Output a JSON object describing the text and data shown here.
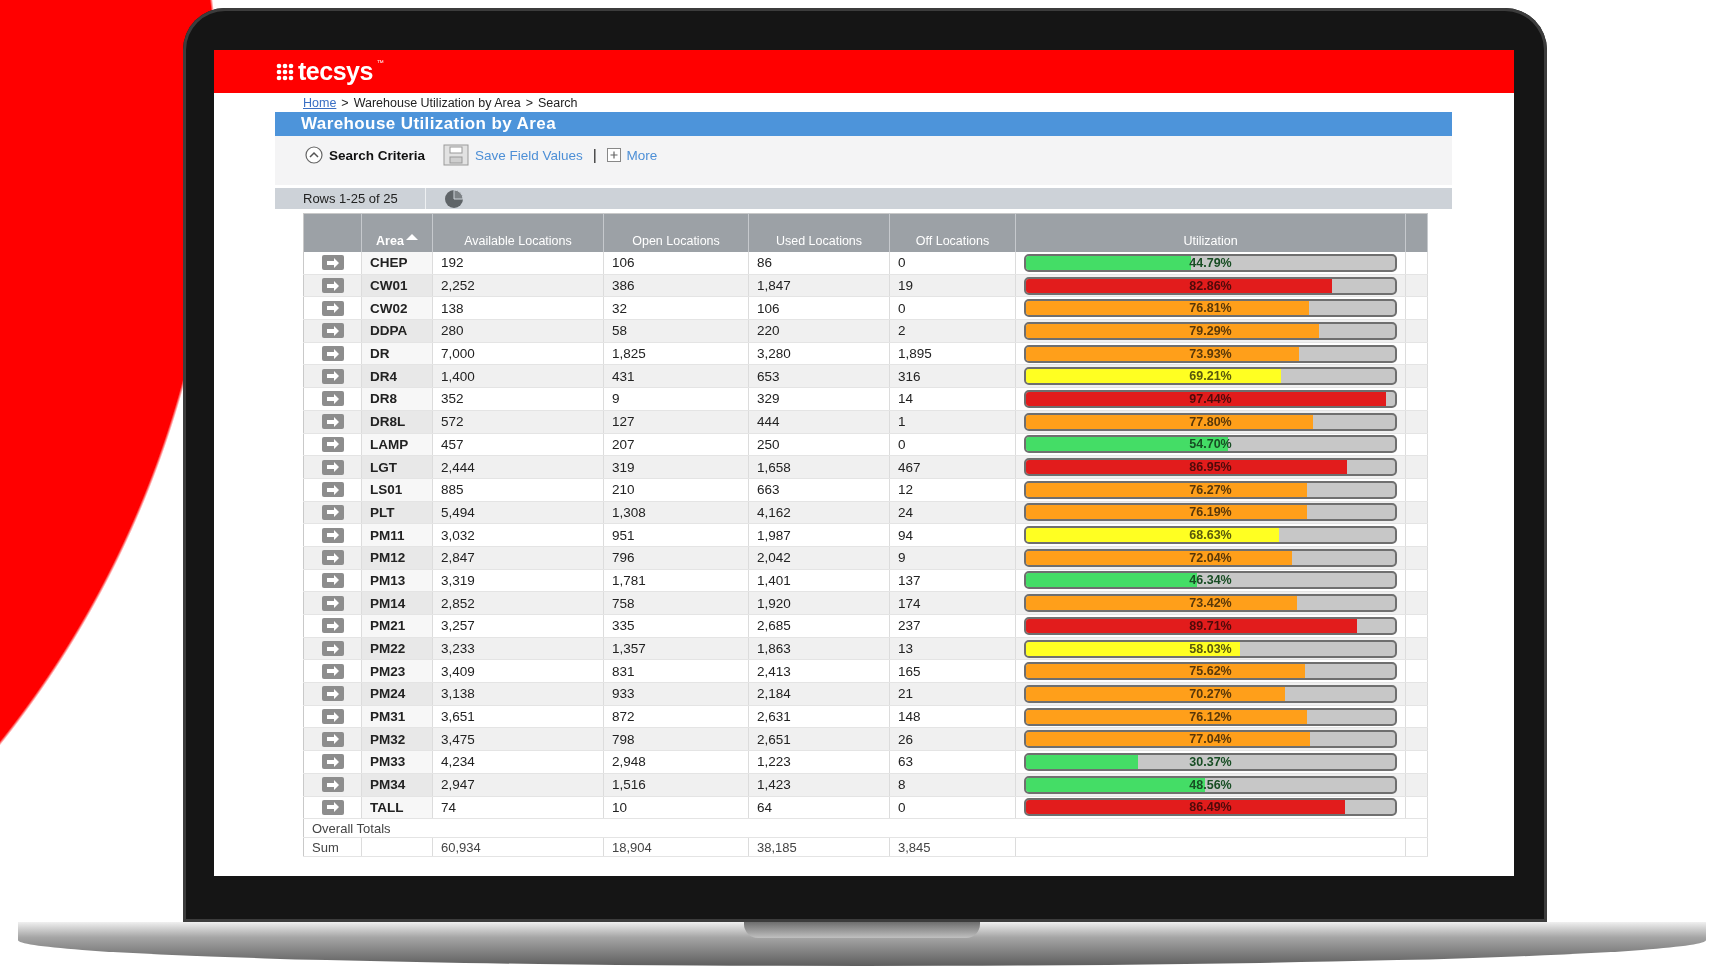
{
  "logo": {
    "text": "tecsys",
    "mark": "™"
  },
  "breadcrumb": {
    "separator": ">",
    "items": [
      {
        "label": "Home",
        "kind": "link"
      },
      {
        "label": "Warehouse Utilization by Area",
        "kind": "text"
      },
      {
        "label": "Search",
        "kind": "text"
      }
    ]
  },
  "title": "Warehouse Utilization by Area",
  "toolbar": {
    "search_criteria": {
      "label": "Search Criteria",
      "expanded": true
    },
    "save": "Save Field Values",
    "separator": "|",
    "more": "More"
  },
  "rows_label": "Rows 1-25 of 25",
  "columns": [
    {
      "label": "Area",
      "sorted": true
    },
    {
      "label": "Available Locations",
      "sorted": false
    },
    {
      "label": "Open Locations",
      "sorted": false
    },
    {
      "label": "Used Locations",
      "sorted": false
    },
    {
      "label": "Off Locations",
      "sorted": false
    },
    {
      "label": "Utilization",
      "sorted": false
    }
  ],
  "rows": [
    {
      "area": "CHEP",
      "available": "192",
      "open": "106",
      "used": "86",
      "off": "0",
      "utilization": "44.79%",
      "level": 0.4479,
      "color": "#44dd66"
    },
    {
      "area": "CW01",
      "available": "2,252",
      "open": "386",
      "used": "1,847",
      "off": "19",
      "utilization": "82.86%",
      "level": 0.8286,
      "color": "#e21c1c"
    },
    {
      "area": "CW02",
      "available": "138",
      "open": "32",
      "used": "106",
      "off": "0",
      "utilization": "76.81%",
      "level": 0.7681,
      "color": "#ff9f1a"
    },
    {
      "area": "DDPA",
      "available": "280",
      "open": "58",
      "used": "220",
      "off": "2",
      "utilization": "79.29%",
      "level": 0.7929,
      "color": "#ff9f1a"
    },
    {
      "area": "DR",
      "available": "7,000",
      "open": "1,825",
      "used": "3,280",
      "off": "1,895",
      "utilization": "73.93%",
      "level": 0.7393,
      "color": "#ff9f1a"
    },
    {
      "area": "DR4",
      "available": "1,400",
      "open": "431",
      "used": "653",
      "off": "316",
      "utilization": "69.21%",
      "level": 0.6921,
      "color": "#ffff22"
    },
    {
      "area": "DR8",
      "available": "352",
      "open": "9",
      "used": "329",
      "off": "14",
      "utilization": "97.44%",
      "level": 0.9744,
      "color": "#e21c1c"
    },
    {
      "area": "DR8L",
      "available": "572",
      "open": "127",
      "used": "444",
      "off": "1",
      "utilization": "77.80%",
      "level": 0.778,
      "color": "#ff9f1a"
    },
    {
      "area": "LAMP",
      "available": "457",
      "open": "207",
      "used": "250",
      "off": "0",
      "utilization": "54.70%",
      "level": 0.547,
      "color": "#44dd66"
    },
    {
      "area": "LGT",
      "available": "2,444",
      "open": "319",
      "used": "1,658",
      "off": "467",
      "utilization": "86.95%",
      "level": 0.8695,
      "color": "#e21c1c"
    },
    {
      "area": "LS01",
      "available": "885",
      "open": "210",
      "used": "663",
      "off": "12",
      "utilization": "76.27%",
      "level": 0.7627,
      "color": "#ff9f1a"
    },
    {
      "area": "PLT",
      "available": "5,494",
      "open": "1,308",
      "used": "4,162",
      "off": "24",
      "utilization": "76.19%",
      "level": 0.7619,
      "color": "#ff9f1a"
    },
    {
      "area": "PM11",
      "available": "3,032",
      "open": "951",
      "used": "1,987",
      "off": "94",
      "utilization": "68.63%",
      "level": 0.6863,
      "color": "#ffff22"
    },
    {
      "area": "PM12",
      "available": "2,847",
      "open": "796",
      "used": "2,042",
      "off": "9",
      "utilization": "72.04%",
      "level": 0.7204,
      "color": "#ff9f1a"
    },
    {
      "area": "PM13",
      "available": "3,319",
      "open": "1,781",
      "used": "1,401",
      "off": "137",
      "utilization": "46.34%",
      "level": 0.4634,
      "color": "#44dd66"
    },
    {
      "area": "PM14",
      "available": "2,852",
      "open": "758",
      "used": "1,920",
      "off": "174",
      "utilization": "73.42%",
      "level": 0.7342,
      "color": "#ff9f1a"
    },
    {
      "area": "PM21",
      "available": "3,257",
      "open": "335",
      "used": "2,685",
      "off": "237",
      "utilization": "89.71%",
      "level": 0.8971,
      "color": "#e21c1c"
    },
    {
      "area": "PM22",
      "available": "3,233",
      "open": "1,357",
      "used": "1,863",
      "off": "13",
      "utilization": "58.03%",
      "level": 0.5803,
      "color": "#ffff22"
    },
    {
      "area": "PM23",
      "available": "3,409",
      "open": "831",
      "used": "2,413",
      "off": "165",
      "utilization": "75.62%",
      "level": 0.7562,
      "color": "#ff9f1a"
    },
    {
      "area": "PM24",
      "available": "3,138",
      "open": "933",
      "used": "2,184",
      "off": "21",
      "utilization": "70.27%",
      "level": 0.7027,
      "color": "#ff9f1a"
    },
    {
      "area": "PM31",
      "available": "3,651",
      "open": "872",
      "used": "2,631",
      "off": "148",
      "utilization": "76.12%",
      "level": 0.7612,
      "color": "#ff9f1a"
    },
    {
      "area": "PM32",
      "available": "3,475",
      "open": "798",
      "used": "2,651",
      "off": "26",
      "utilization": "77.04%",
      "level": 0.7704,
      "color": "#ff9f1a"
    },
    {
      "area": "PM33",
      "available": "4,234",
      "open": "2,948",
      "used": "1,223",
      "off": "63",
      "utilization": "30.37%",
      "level": 0.3037,
      "color": "#44dd66"
    },
    {
      "area": "PM34",
      "available": "2,947",
      "open": "1,516",
      "used": "1,423",
      "off": "8",
      "utilization": "48.56%",
      "level": 0.4856,
      "color": "#44dd66"
    },
    {
      "area": "TALL",
      "available": "74",
      "open": "10",
      "used": "64",
      "off": "0",
      "utilization": "86.49%",
      "level": 0.8649,
      "color": "#e21c1c"
    }
  ],
  "totals": {
    "label": "Overall Totals",
    "sum_label": "Sum",
    "sums": [
      "60,934",
      "18,904",
      "38,185",
      "3,845"
    ]
  }
}
